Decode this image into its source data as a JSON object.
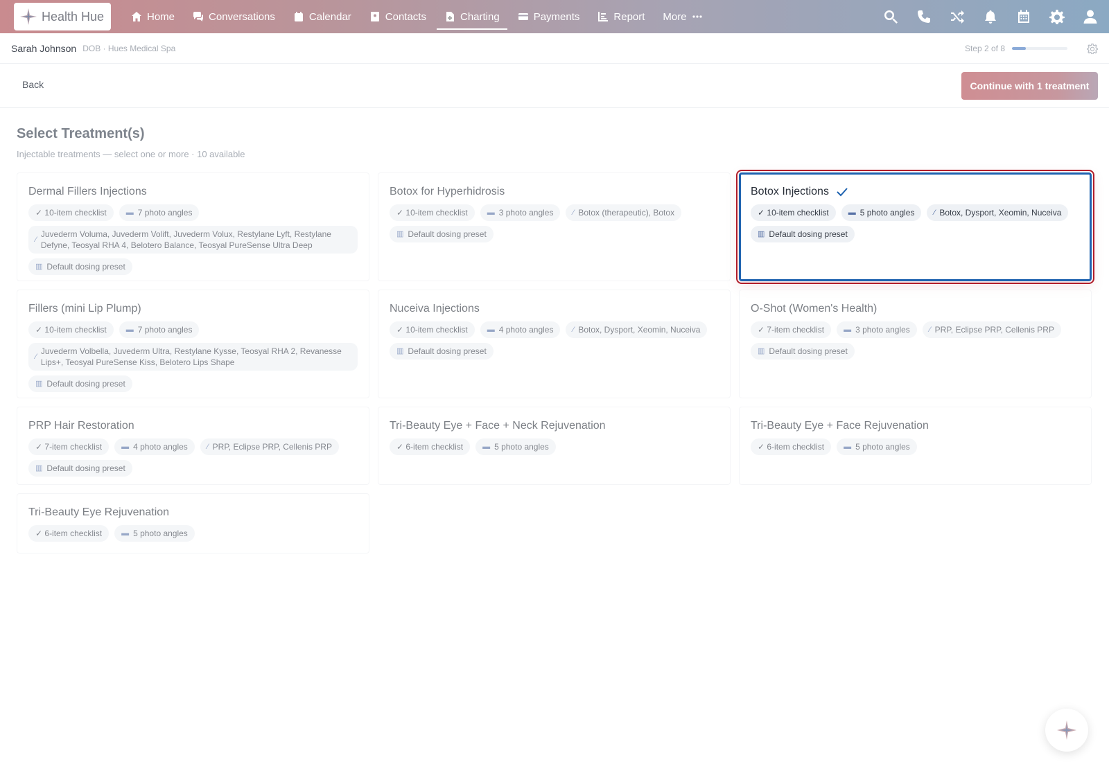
{
  "app": {
    "name": "Health Hue"
  },
  "nav": {
    "items": [
      {
        "label": "Home",
        "icon": "home-icon"
      },
      {
        "label": "Conversations",
        "icon": "chat-icon"
      },
      {
        "label": "Calendar",
        "icon": "calendar-icon"
      },
      {
        "label": "Contacts",
        "icon": "contacts-icon"
      },
      {
        "label": "Charting",
        "icon": "chart-doc-icon",
        "active": true
      },
      {
        "label": "Payments",
        "icon": "card-icon"
      },
      {
        "label": "Report",
        "icon": "report-icon"
      },
      {
        "label": "More",
        "icon": "more-icon"
      }
    ],
    "right_icons": [
      "search-icon",
      "phone-icon",
      "shuffle-icon",
      "bell-icon",
      "calendar-grid-icon",
      "gear-icon",
      "user-icon"
    ]
  },
  "patient": {
    "name": "Sarah Johnson",
    "meta": "DOB · Hues Medical Spa",
    "step": "Step 2 of 8",
    "progress": 0.25
  },
  "actions": {
    "back": "Back",
    "continue": "Continue with 1 treatment"
  },
  "section": {
    "title": "Select Treatment(s)",
    "subtitle": "Injectable treatments — select one or more · 10 available"
  },
  "treatments": [
    {
      "title": "Dermal Fillers Injections",
      "checklist": "✓ 10-item checklist",
      "photos": "7 photo angles",
      "products": "Juvederm Voluma, Juvederm Volift, Juvederm Volux, Restylane Lyft, Restylane Defyne, Teosyal RHA 4, Belotero Balance, Teosyal PureSense Ultra Deep",
      "preset": "Default dosing preset"
    },
    {
      "title": "Botox for Hyperhidrosis",
      "checklist": "✓ 10-item checklist",
      "photos": "3 photo angles",
      "products": "Botox (therapeutic), Botox",
      "preset": "Default dosing preset"
    },
    {
      "title": "Botox Injections",
      "selected": true,
      "checklist": "✓ 10-item checklist",
      "photos": "5 photo angles",
      "products": "Botox, Dysport, Xeomin, Nuceiva",
      "preset": "Default dosing preset"
    },
    {
      "title": "Fillers (mini Lip Plump)",
      "checklist": "✓ 10-item checklist",
      "photos": "7 photo angles",
      "products": "Juvederm Volbella, Juvederm Ultra, Restylane Kysse, Teosyal RHA 2, Revanesse Lips+, Teosyal PureSense Kiss, Belotero Lips Shape",
      "preset": "Default dosing preset"
    },
    {
      "title": "Nuceiva Injections",
      "checklist": "✓ 10-item checklist",
      "photos": "4 photo angles",
      "products": "Botox, Dysport, Xeomin, Nuceiva",
      "preset": "Default dosing preset"
    },
    {
      "title": "O-Shot (Women's Health)",
      "checklist": "✓ 7-item checklist",
      "photos": "3 photo angles",
      "products": "PRP, Eclipse PRP, Cellenis PRP",
      "preset": "Default dosing preset"
    },
    {
      "title": "PRP Hair Restoration",
      "checklist": "✓ 7-item checklist",
      "photos": "4 photo angles",
      "products": "PRP, Eclipse PRP, Cellenis PRP",
      "preset": "Default dosing preset"
    },
    {
      "title": "Tri-Beauty Eye + Face + Neck Rejuvenation",
      "checklist": "✓ 6-item checklist",
      "photos": "5 photo angles"
    },
    {
      "title": "Tri-Beauty Eye + Face Rejuvenation",
      "checklist": "✓ 6-item checklist",
      "photos": "5 photo angles"
    },
    {
      "title": "Tri-Beauty Eye Rejuvenation",
      "checklist": "✓ 6-item checklist",
      "photos": "5 photo angles"
    }
  ],
  "colors": {
    "accent": "#1f63b0",
    "selection_outline": "#b11d2a",
    "brand_gradient_start": "#c98b8f",
    "brand_gradient_end": "#8ba9c3"
  }
}
